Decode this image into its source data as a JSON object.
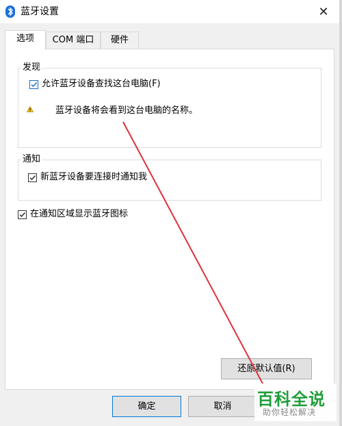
{
  "window": {
    "title": "蓝牙设置",
    "close_glyph": "✕",
    "icon": "bluetooth-icon"
  },
  "tabs": [
    {
      "label": "选项",
      "active": true
    },
    {
      "label": "COM 端口",
      "active": false
    },
    {
      "label": "硬件",
      "active": false
    }
  ],
  "discovery": {
    "title": "发现",
    "allow_label": "允许蓝牙设备查找这台电脑(F)",
    "allow_checked": true,
    "warning_text": "蓝牙设备将会看到这台电脑的名称。",
    "warning_icon": "warning-icon"
  },
  "notify": {
    "title": "通知",
    "new_device_label": "新蓝牙设备要连接时通知我",
    "new_device_checked": true
  },
  "tray": {
    "label": "在通知区域显示蓝牙图标",
    "checked": true
  },
  "buttons": {
    "restore": "还原默认值(R)",
    "ok": "确定",
    "cancel": "取消"
  },
  "watermark": {
    "main": "百科全说",
    "sub": "助你轻松解决"
  },
  "colors": {
    "accent": "#0078d7",
    "annotation": "#e0303a",
    "watermark": "#1f9d3a"
  }
}
